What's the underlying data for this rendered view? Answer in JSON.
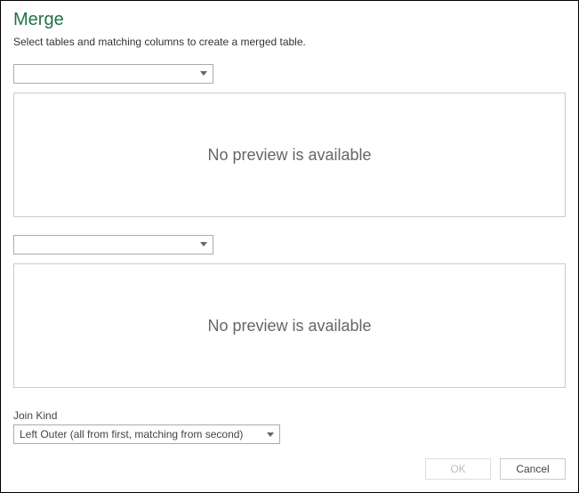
{
  "title": "Merge",
  "instruction": "Select tables and matching columns to create a merged table.",
  "table1": {
    "selected": "",
    "preview_msg": "No preview is available"
  },
  "table2": {
    "selected": "",
    "preview_msg": "No preview is available"
  },
  "join": {
    "label": "Join Kind",
    "selected": "Left Outer (all from first, matching from second)"
  },
  "buttons": {
    "ok": "OK",
    "cancel": "Cancel"
  }
}
